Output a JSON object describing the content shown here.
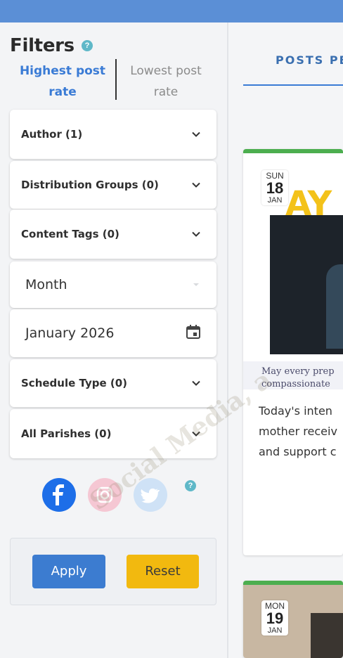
{
  "filters": {
    "title": "Filters",
    "help_icon": "question-circle-icon",
    "sort_tabs": [
      {
        "label": "Highest post rate",
        "active": true
      },
      {
        "label": "Lowest post rate",
        "active": false
      }
    ],
    "dropdowns": [
      {
        "label": "Author (1)"
      },
      {
        "label": "Distribution Groups (0)"
      },
      {
        "label": "Content Tags (0)"
      }
    ],
    "period_select": {
      "value": "Month"
    },
    "date_input": {
      "value": "January 2026",
      "icon": "calendar-icon"
    },
    "dropdowns2": [
      {
        "label": "Schedule Type (0)"
      },
      {
        "label": "All Parishes (0)"
      }
    ],
    "social_icons": [
      "facebook-icon",
      "instagram-icon",
      "twitter-icon"
    ],
    "apply_label": "Apply",
    "reset_label": "Reset"
  },
  "main": {
    "tab_label": "POSTS PE",
    "posts": [
      {
        "day": "SUN",
        "date": "18",
        "month": "JAN",
        "banner": "AY",
        "caption_lines": [
          "May every prep",
          "compassionate"
        ],
        "text_lines": [
          "Today's inten",
          "mother receiv",
          "and support c"
        ]
      },
      {
        "day": "MON",
        "date": "19",
        "month": "JAN"
      }
    ]
  },
  "watermark": "Social Media, a",
  "colors": {
    "topbar": "#5b8fd6",
    "accent_blue": "#3a7bd5",
    "apply": "#3c7cd0",
    "reset": "#f2b90f",
    "post_border": "#4cae4f"
  }
}
